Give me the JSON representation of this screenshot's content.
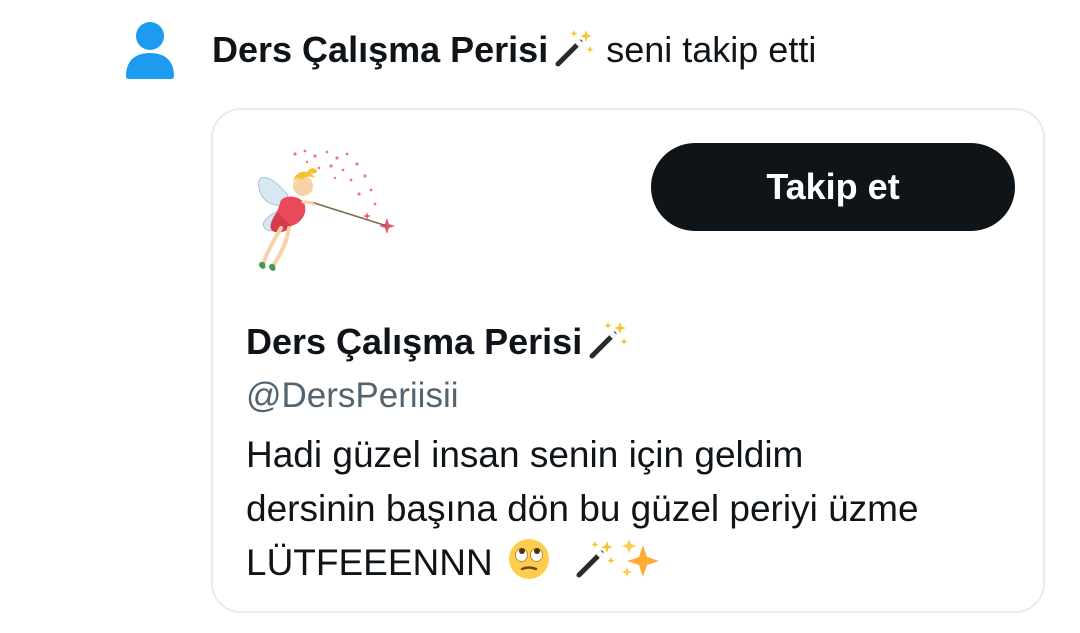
{
  "notification": {
    "actor_name": "Ders Çalışma Perisi",
    "action_text": " seni takip etti",
    "actor_emoji": "magic-wand-emoji"
  },
  "profile_card": {
    "display_name": "Ders Çalışma Perisi",
    "name_emoji": "magic-wand-emoji",
    "handle": "@DersPeriisii",
    "follow_label": "Takip et",
    "bio_lines": [
      "Hadi güzel insan senin için geldim",
      "dersinin başına dön bu güzel periyi üzme",
      "LÜTFEEENNN"
    ],
    "bio_emojis": [
      "face-with-rolling-eyes-emoji",
      "magic-wand-emoji",
      "sparkles-emoji"
    ]
  },
  "colors": {
    "text_primary": "#0f1419",
    "text_secondary": "#536471",
    "card_border": "#e6ecf0",
    "button_bg": "#0f1419",
    "button_text": "#ffffff",
    "person_icon": "#1d9bf0"
  }
}
